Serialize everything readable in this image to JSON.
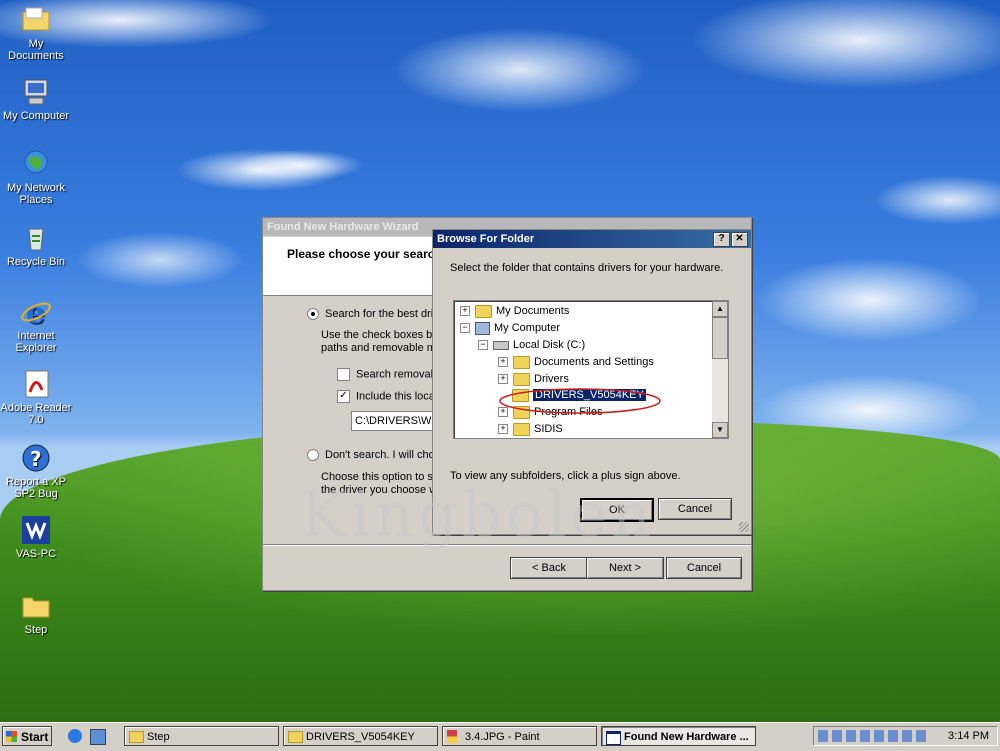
{
  "desktop_icons": [
    {
      "label": "My Documents"
    },
    {
      "label": "My Computer"
    },
    {
      "label": "My Network Places"
    },
    {
      "label": "Recycle Bin"
    },
    {
      "label": "Internet Explorer"
    },
    {
      "label": "Adobe Reader 7.0"
    },
    {
      "label": "Report a XP SP2 Bug"
    },
    {
      "label": "VAS-PC"
    },
    {
      "label": "Step"
    }
  ],
  "wizard": {
    "title": "Found New Hardware Wizard",
    "heading": "Please choose your searc",
    "option_search": "Search for the best driv",
    "option_search_desc_1": "Use the check boxes be",
    "option_search_desc_2": "paths and removable me",
    "check_removable": "Search removabl",
    "check_include": "Include this locat",
    "path_value": "C:\\DRIVERS\\W",
    "option_dont": "Don't search. I will choo",
    "option_dont_desc_1": "Choose this option to se",
    "option_dont_desc_2": "the driver you choose w",
    "back_label": "< Back",
    "next_label": "Next >",
    "cancel_label": "Cancel"
  },
  "browse": {
    "title": "Browse For Folder",
    "help_glyph": "?",
    "close_glyph": "✕",
    "instruction": "Select the folder that contains drivers for your hardware.",
    "tree": [
      {
        "label": "My Documents",
        "expander": "+",
        "level": 0
      },
      {
        "label": "My Computer",
        "expander": "−",
        "level": 0
      },
      {
        "label": "Local Disk (C:)",
        "expander": "−",
        "level": 1
      },
      {
        "label": "Documents and Settings",
        "expander": "+",
        "level": 2
      },
      {
        "label": "Drivers",
        "expander": "+",
        "level": 2
      },
      {
        "label": "DRIVERS_V5054KEY",
        "expander": "",
        "level": 2,
        "selected": true
      },
      {
        "label": "Program Files",
        "expander": "+",
        "level": 2
      },
      {
        "label": "SIDIS",
        "expander": "+",
        "level": 2
      }
    ],
    "hint": "To view any subfolders, click a plus sign above.",
    "ok_label": "OK",
    "cancel_label": "Cancel"
  },
  "watermark": "Kingbolen",
  "taskbar": {
    "start_label": "Start",
    "tasks": [
      {
        "label": "Step"
      },
      {
        "label": "DRIVERS_V5054KEY"
      },
      {
        "label": "3.4.JPG - Paint"
      },
      {
        "label": "Found New Hardware ..."
      }
    ],
    "clock": "3:14 PM"
  },
  "colors": {
    "title_active": "#0a246a",
    "selection": "#0a246a",
    "annotation_ellipse": "#c81e1e"
  }
}
